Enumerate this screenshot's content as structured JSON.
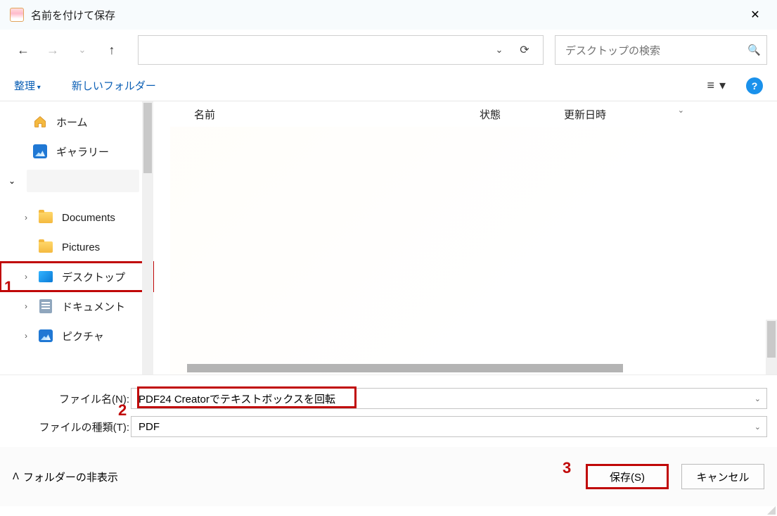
{
  "window": {
    "title": "名前を付けて保存"
  },
  "search": {
    "placeholder": "デスクトップの検索"
  },
  "toolbar": {
    "organize_label": "整理",
    "newfolder_label": "新しいフォルダー"
  },
  "sidebar": {
    "home": "ホーム",
    "gallery": "ギャラリー",
    "documents": "Documents",
    "pictures": "Pictures",
    "desktop": "デスクトップ",
    "document_jp": "ドキュメント",
    "picture_jp": "ピクチャ"
  },
  "columns": {
    "name": "名前",
    "status": "状態",
    "modified": "更新日時"
  },
  "form": {
    "filename_label": "ファイル名(N):",
    "filetype_label": "ファイルの種類(T):",
    "filename_value": "PDF24 Creatorでテキストボックスを回転",
    "filetype_value": "PDF"
  },
  "footer": {
    "hide_folders": "フォルダーの非表示",
    "save_label": "保存(S)",
    "cancel_label": "キャンセル"
  },
  "annotations": {
    "a1": "1",
    "a2": "2",
    "a3": "3"
  }
}
